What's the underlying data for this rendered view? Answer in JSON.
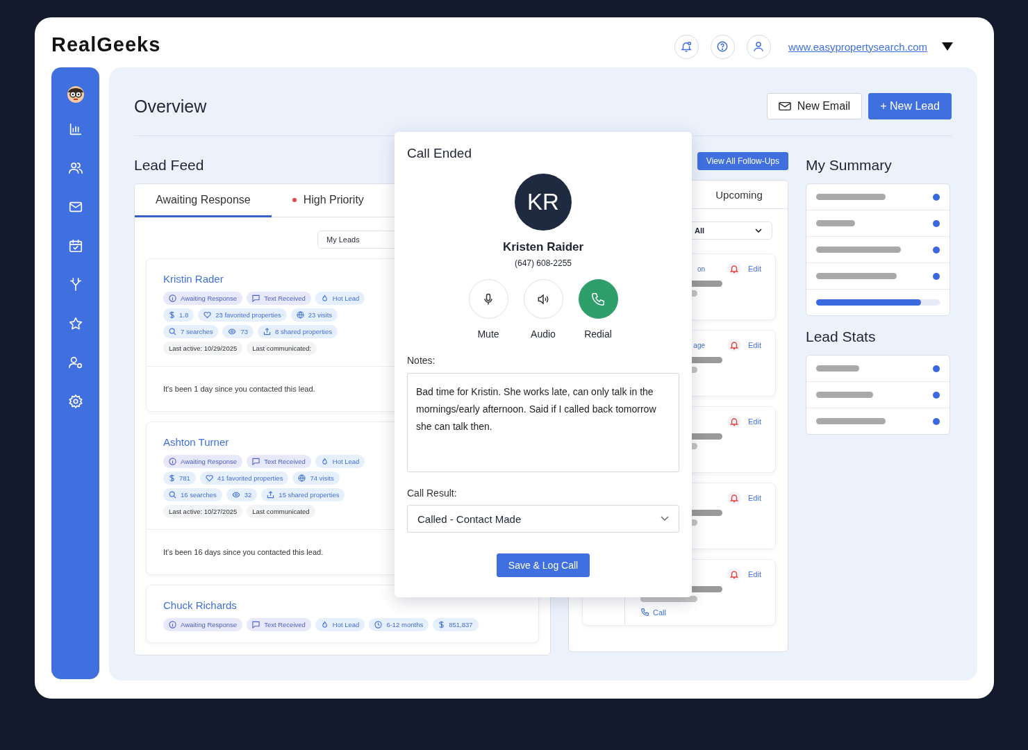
{
  "header": {
    "logo": "RealGeeks",
    "site_link": "www.easypropertysearch.com"
  },
  "overview": {
    "title": "Overview",
    "buttons": [
      {
        "label": "New Email",
        "kind": "secondary"
      },
      {
        "label": "+ New Lead",
        "kind": "primary"
      }
    ]
  },
  "lead_feed": {
    "title": "Lead Feed",
    "tabs": [
      {
        "label": "Awaiting Response",
        "selected": true,
        "dot": false
      },
      {
        "label": "High Priority",
        "selected": false,
        "dot": true
      }
    ],
    "filter": "My Leads",
    "leads": [
      {
        "name": "Kristin Rader",
        "chips": [
          {
            "kind": "status",
            "label": "Awaiting Response"
          },
          {
            "kind": "message",
            "label": "Text Received"
          },
          {
            "kind": "hot",
            "label": "Hot Lead"
          },
          {
            "kind": "price",
            "label": "1.8"
          },
          {
            "kind": "favorites",
            "label": "23 favorited properties"
          },
          {
            "kind": "visits",
            "label": "23 visits"
          },
          {
            "kind": "searches",
            "label": "7 searches"
          },
          {
            "kind": "views",
            "label": "73"
          },
          {
            "kind": "shared",
            "label": "8 shared properties"
          },
          {
            "kind": "activity",
            "label": "Last active: 10/29/2025"
          },
          {
            "kind": "activity",
            "label": "Last communicated:"
          }
        ],
        "note": "It's been 1 day since you contacted this lead."
      },
      {
        "name": "Ashton Turner",
        "chips": [
          {
            "kind": "status",
            "label": "Awaiting Response"
          },
          {
            "kind": "message",
            "label": "Text Received"
          },
          {
            "kind": "hot",
            "label": "Hot Lead"
          },
          {
            "kind": "price",
            "label": "781"
          },
          {
            "kind": "favorites",
            "label": "41 favorited properties"
          },
          {
            "kind": "visits",
            "label": "74 visits"
          },
          {
            "kind": "searches",
            "label": "16 searches"
          },
          {
            "kind": "views",
            "label": "32"
          },
          {
            "kind": "shared",
            "label": "15 shared properties"
          },
          {
            "kind": "activity",
            "label": "Last active: 10/27/2025"
          },
          {
            "kind": "activity",
            "label": "Last communicated"
          }
        ],
        "note": "It's been 16 days since you contacted this lead."
      },
      {
        "name": "Chuck Richards",
        "chips": [
          {
            "kind": "status",
            "label": "Awaiting Response"
          },
          {
            "kind": "message",
            "label": "Text Received"
          },
          {
            "kind": "hot",
            "label": "Hot Lead"
          },
          {
            "kind": "timeframe",
            "label": "6-12 months"
          },
          {
            "kind": "price",
            "label": "851,837"
          }
        ]
      }
    ]
  },
  "follow_ups": {
    "button": "View All Follow-Ups",
    "tab": "Upcoming",
    "filter": "All",
    "items": [
      {
        "link": "on",
        "edit": "Edit"
      },
      {
        "link": "age",
        "edit": "Edit"
      },
      {
        "edit": "Edit"
      },
      {
        "edit": "Edit"
      },
      {
        "edit": "Edit",
        "call": "Call"
      }
    ]
  },
  "summary": {
    "title": "My Summary",
    "rows": [
      {
        "kind": "item"
      },
      {
        "kind": "item"
      },
      {
        "kind": "item"
      },
      {
        "kind": "item"
      },
      {
        "kind": "total",
        "level": 0.85
      }
    ]
  },
  "lead_stats": {
    "title": "Lead Stats",
    "rows": [
      {
        "kind": "item"
      },
      {
        "kind": "item"
      },
      {
        "kind": "item"
      }
    ]
  },
  "call_modal": {
    "title": "Call Ended",
    "initials": "KR",
    "name": "Kristen Raider",
    "phone": "(647) 608-2255",
    "controls": [
      {
        "label": "Mute",
        "kind": "mute"
      },
      {
        "label": "Audio",
        "kind": "audio"
      },
      {
        "label": "Redial",
        "kind": "redial"
      }
    ],
    "notes_label": "Notes:",
    "notes": "Bad time for Kristin. She works late, can only talk in the mornings/early afternoon. Said if I called back tomorrow she can talk then.",
    "result_label": "Call Result:",
    "result": "Called - Contact Made",
    "submit": "Save & Log Call"
  }
}
